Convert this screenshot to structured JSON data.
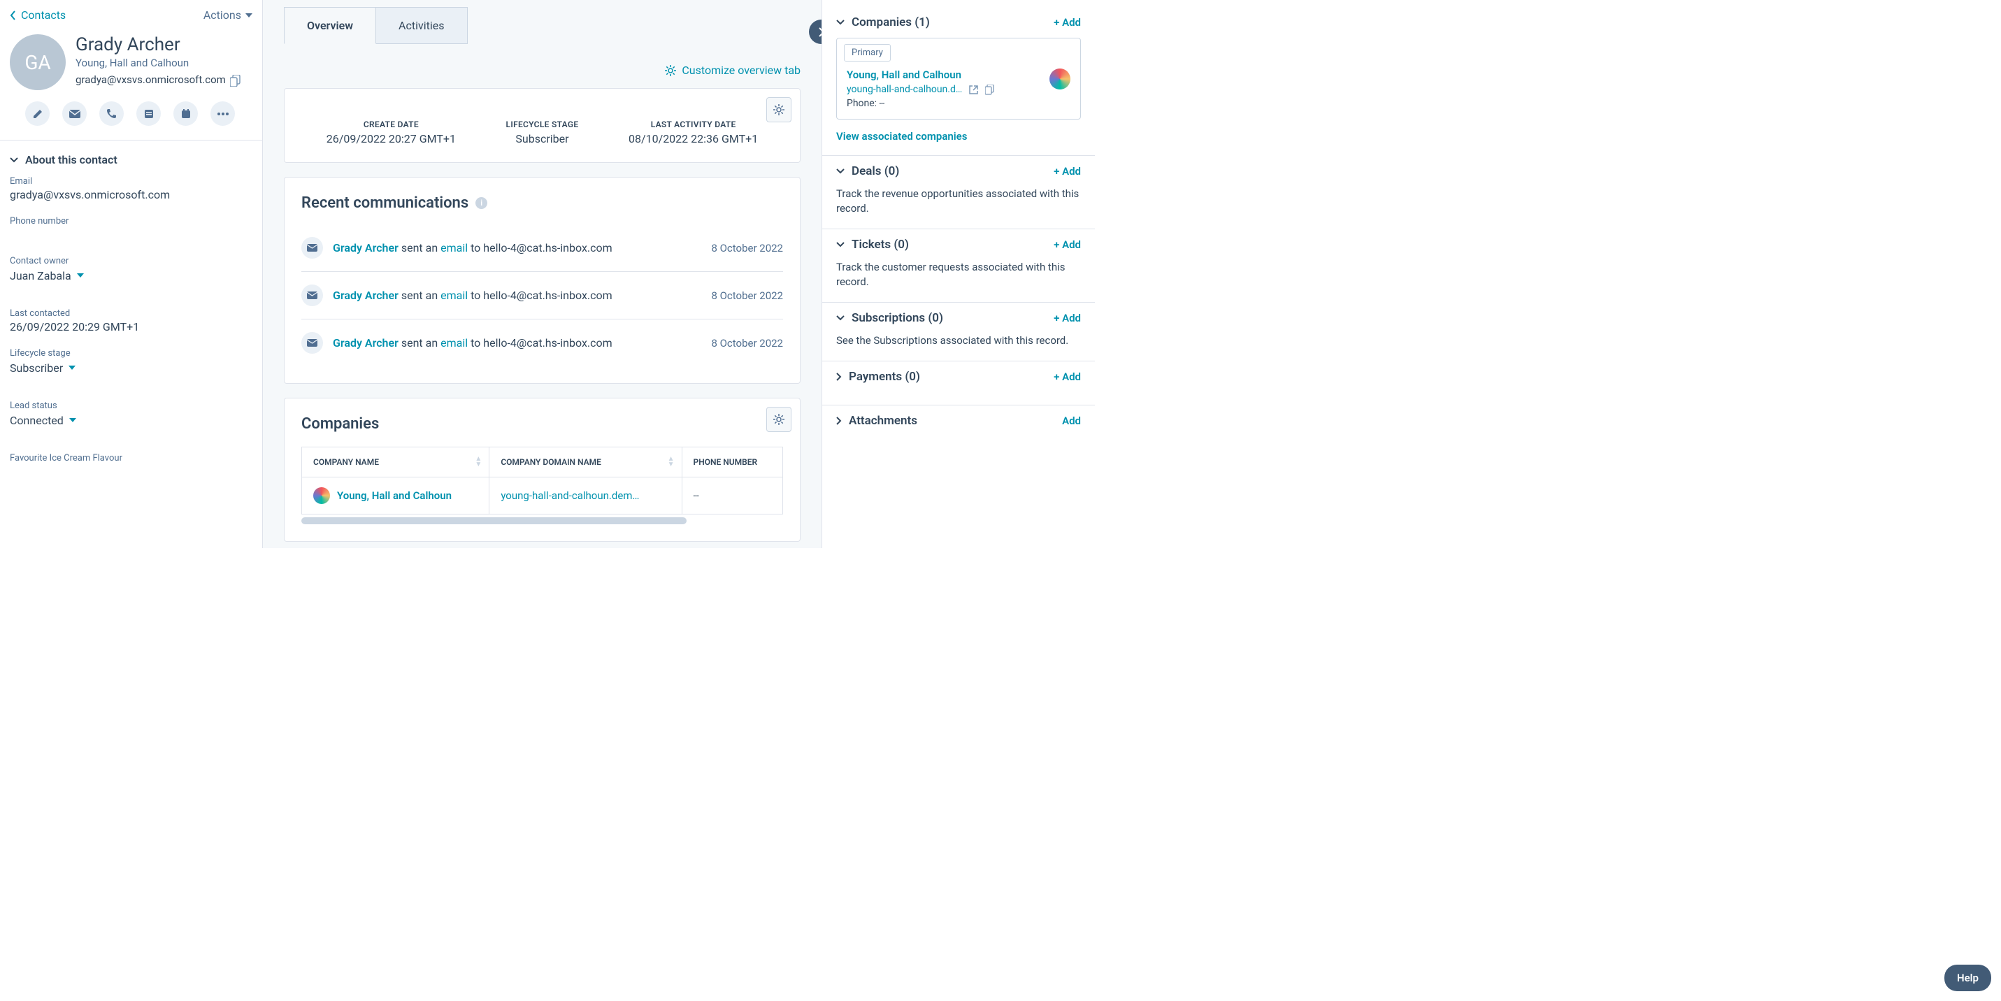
{
  "nav": {
    "back": "Contacts",
    "actions": "Actions"
  },
  "contact": {
    "initials": "GA",
    "name": "Grady Archer",
    "company": "Young, Hall and Calhoun",
    "email": "gradya@vxsvs.onmicrosoft.com"
  },
  "about": {
    "title": "About this contact",
    "email_label": "Email",
    "email_value": "gradya@vxsvs.onmicrosoft.com",
    "phone_label": "Phone number",
    "phone_value": "",
    "owner_label": "Contact owner",
    "owner_value": "Juan Zabala",
    "last_contacted_label": "Last contacted",
    "last_contacted_value": "26/09/2022 20:29 GMT+1",
    "lifecycle_label": "Lifecycle stage",
    "lifecycle_value": "Subscriber",
    "lead_status_label": "Lead status",
    "lead_status_value": "Connected",
    "flavour_label": "Favourite Ice Cream Flavour"
  },
  "tabs": {
    "overview": "Overview",
    "activities": "Activities"
  },
  "customize": "Customize overview tab",
  "summary": {
    "create_label": "CREATE DATE",
    "create_value": "26/09/2022 20:27 GMT+1",
    "lifecycle_label": "LIFECYCLE STAGE",
    "lifecycle_value": "Subscriber",
    "activity_label": "LAST ACTIVITY DATE",
    "activity_value": "08/10/2022 22:36 GMT+1"
  },
  "comms": {
    "title": "Recent communications",
    "rows": [
      {
        "name": "Grady Archer",
        "mid": " sent an ",
        "link": "email",
        "to": " to hello-4@cat.hs-inbox.com",
        "date": "8 October 2022"
      },
      {
        "name": "Grady Archer",
        "mid": " sent an ",
        "link": "email",
        "to": " to hello-4@cat.hs-inbox.com",
        "date": "8 October 2022"
      },
      {
        "name": "Grady Archer",
        "mid": " sent an ",
        "link": "email",
        "to": " to hello-4@cat.hs-inbox.com",
        "date": "8 October 2022"
      }
    ]
  },
  "companies_table": {
    "title": "Companies",
    "col_name": "COMPANY NAME",
    "col_domain": "COMPANY DOMAIN NAME",
    "col_phone": "PHONE NUMBER",
    "row_name": "Young, Hall and Calhoun",
    "row_domain": "young-hall-and-calhoun.dem…",
    "row_phone": "--"
  },
  "right": {
    "companies": {
      "title": "Companies (1)",
      "add": "+ Add",
      "primary": "Primary",
      "name": "Young, Hall and Calhoun",
      "domain": "young-hall-and-calhoun.d…",
      "phone": "Phone: --",
      "view": "View associated companies"
    },
    "deals": {
      "title": "Deals (0)",
      "add": "+ Add",
      "desc": "Track the revenue opportunities associated with this record."
    },
    "tickets": {
      "title": "Tickets (0)",
      "add": "+ Add",
      "desc": "Track the customer requests associated with this record."
    },
    "subscriptions": {
      "title": "Subscriptions (0)",
      "add": "+ Add",
      "desc": "See the Subscriptions associated with this record."
    },
    "payments": {
      "title": "Payments (0)",
      "add": "+ Add"
    },
    "attachments": {
      "title": "Attachments",
      "add": "Add"
    }
  },
  "help": "Help"
}
